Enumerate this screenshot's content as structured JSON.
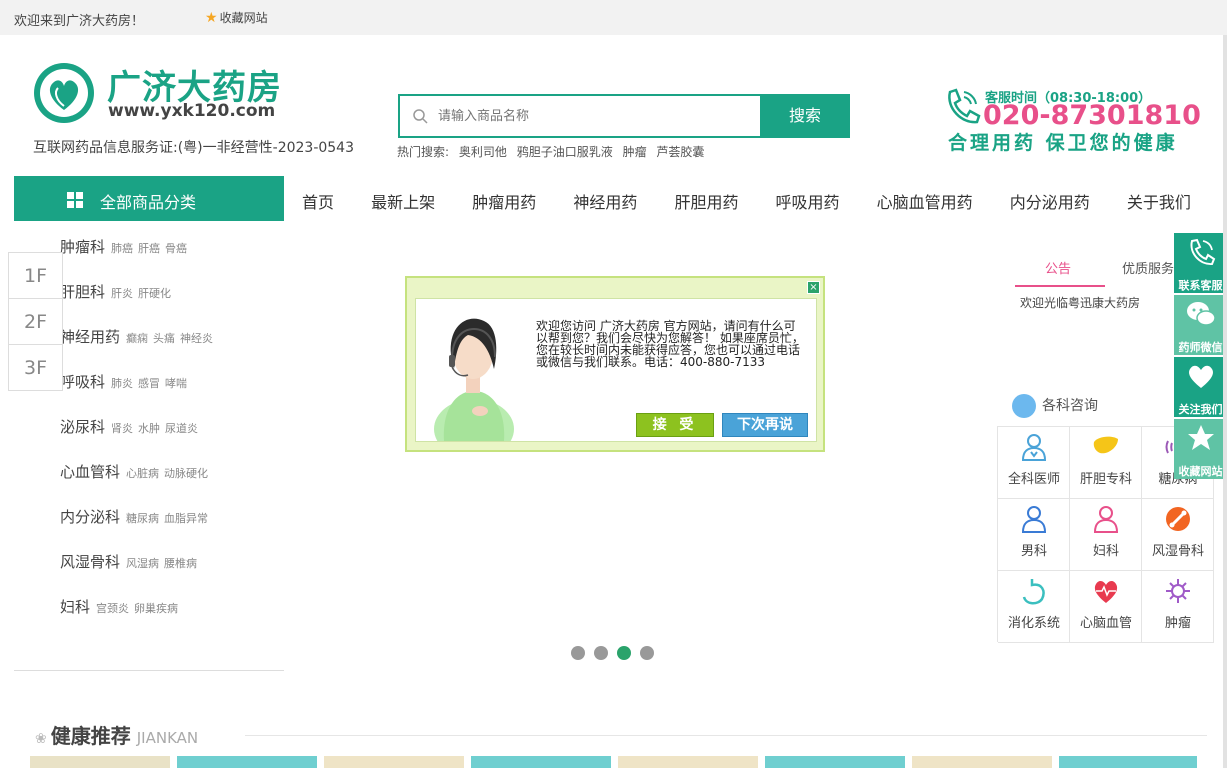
{
  "topbar": {
    "welcome": "欢迎来到广济大药房！",
    "favorite": "收藏网站"
  },
  "logo": {
    "name": "广济大药房",
    "url": "www.yxk120.com"
  },
  "license": "互联网药品信息服务证:(粤)一非经营性-2023-0543",
  "search": {
    "placeholder": "请输入商品名称",
    "button": "搜索",
    "hot_label": "热门搜索:",
    "hot_words": [
      "奥利司他",
      "鸦胆子油口服乳液",
      "肿瘤",
      "芦荟胶囊"
    ]
  },
  "hotline": {
    "hours": "客服时间（08:30-18:00）",
    "number": "020-87301810",
    "slogan": "合理用药 保卫您的健康"
  },
  "category_button": "全部商品分类",
  "nav": [
    "首页",
    "最新上架",
    "肿瘤用药",
    "神经用药",
    "肝胆用药",
    "呼吸用药",
    "心脑血管用药",
    "内分泌用药",
    "关于我们"
  ],
  "categories": [
    {
      "name": "肿瘤科",
      "subs": [
        "肺癌",
        "肝癌",
        "骨癌"
      ]
    },
    {
      "name": "肝胆科",
      "subs": [
        "肝炎",
        "肝硬化"
      ]
    },
    {
      "name": "神经用药",
      "subs": [
        "癫痫",
        "头痛",
        "神经炎"
      ]
    },
    {
      "name": "呼吸科",
      "subs": [
        "肺炎",
        "感冒",
        "哮喘"
      ]
    },
    {
      "name": "泌尿科",
      "subs": [
        "肾炎",
        "水肿",
        "尿道炎"
      ]
    },
    {
      "name": "心血管科",
      "subs": [
        "心脏病",
        "动脉硬化"
      ]
    },
    {
      "name": "内分泌科",
      "subs": [
        "糖尿病",
        "血脂异常"
      ]
    },
    {
      "name": "风湿骨科",
      "subs": [
        "风湿病",
        "腰椎病"
      ]
    },
    {
      "name": "妇科",
      "subs": [
        "宫颈炎",
        "卵巢疾病"
      ]
    }
  ],
  "floors": [
    "1F",
    "2F",
    "3F"
  ],
  "popup": {
    "message": "欢迎您访问 广济大药房 官方网站，请问有什么可以帮到您？我们会尽快为您解答！ 如果座席员忙，您在较长时间内未能获得应答，您也可以通过电话或微信与我们联系。电话：400-880-7133",
    "accept": "接 受",
    "later": "下次再说",
    "close": "×"
  },
  "carousel": {
    "count": 4,
    "active_index": 2
  },
  "notice": {
    "tabs": [
      "公告",
      "优质服务"
    ],
    "text": "欢迎光临粤迅康大药房"
  },
  "departments": {
    "title": "各科咨询",
    "items": [
      {
        "label": "全科医师",
        "icon": "doctor-icon",
        "color": "#4aa3d8"
      },
      {
        "label": "肝胆专科",
        "icon": "liver-icon",
        "color": "#f5c518"
      },
      {
        "label": "糖尿病",
        "icon": "sugar-icon",
        "color": "#9b59b6"
      },
      {
        "label": "男科",
        "icon": "male-icon",
        "color": "#3a7bd5"
      },
      {
        "label": "妇科",
        "icon": "female-icon",
        "color": "#e8508a"
      },
      {
        "label": "风湿骨科",
        "icon": "bone-icon",
        "color": "#f26522"
      },
      {
        "label": "消化系统",
        "icon": "stomach-icon",
        "color": "#3bbfbf"
      },
      {
        "label": "心脑血管",
        "icon": "heart-icon",
        "color": "#e83a4f"
      },
      {
        "label": "肿瘤",
        "icon": "virus-icon",
        "color": "#a05ac8"
      }
    ]
  },
  "side_float": [
    {
      "label": "联系客服",
      "icon": "phone-icon"
    },
    {
      "label": "药师微信",
      "icon": "wechat-icon"
    },
    {
      "label": "关注我们",
      "icon": "heart-icon"
    },
    {
      "label": "收藏网站",
      "icon": "star-icon"
    }
  ],
  "health": {
    "title": "健康推荐",
    "subtitle": "JIANKAN"
  },
  "colors": {
    "brand": "#1aa385",
    "accent": "#e8508a"
  }
}
